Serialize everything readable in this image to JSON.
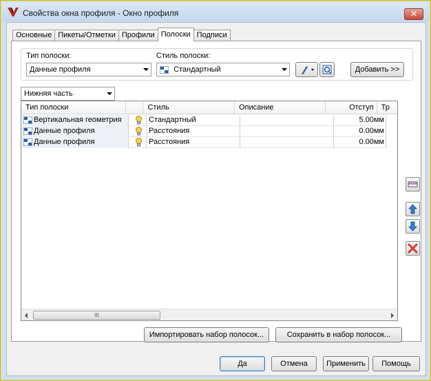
{
  "window": {
    "title": "Свойства окна профиля - Окно профиля",
    "close_glyph": "✕"
  },
  "tabs": [
    {
      "label": "Основные",
      "active": false
    },
    {
      "label": "Пикеты/Отметки",
      "active": false
    },
    {
      "label": "Профили",
      "active": false
    },
    {
      "label": "Полоски",
      "active": true
    },
    {
      "label": "Подписи",
      "active": false
    }
  ],
  "band_settings": {
    "type_label": "Тип полоски:",
    "type_value": "Данные профиля",
    "style_label": "Стиль полоски:",
    "style_value": "Стандартный",
    "add_button": "Добавить >>"
  },
  "location": {
    "value": "Нижняя часть"
  },
  "table": {
    "columns": [
      "Тип полоски",
      "",
      "Стиль",
      "Описание",
      "Отступ",
      "Тр"
    ],
    "rows": [
      {
        "type": "Вертикальная геометрия",
        "style": "Стандартный",
        "description": "",
        "offset": "5.00мм"
      },
      {
        "type": "Данные профиля",
        "style": "Расстояния",
        "description": "",
        "offset": "0.00мм"
      },
      {
        "type": "Данные профиля",
        "style": "Расстояния",
        "description": "",
        "offset": "0.00мм"
      }
    ],
    "scroll_grip": "III"
  },
  "import_button": "Импортировать набор полосок...",
  "save_button": "Сохранить в набор полосок...",
  "footer": {
    "ok": "Да",
    "cancel": "Отмена",
    "apply": "Применить",
    "help": "Помощь"
  },
  "colors": {
    "accent_blue": "#2b5fa8",
    "delete_red": "#d23c2a",
    "bulb_yellow": "#f3d54a"
  },
  "icons": [
    "profile-window-icon",
    "band-type-icon",
    "style-edit-icon",
    "style-preview-icon",
    "lightbulb-icon",
    "match-settings-icon",
    "move-up-icon",
    "move-down-icon",
    "delete-icon"
  ]
}
